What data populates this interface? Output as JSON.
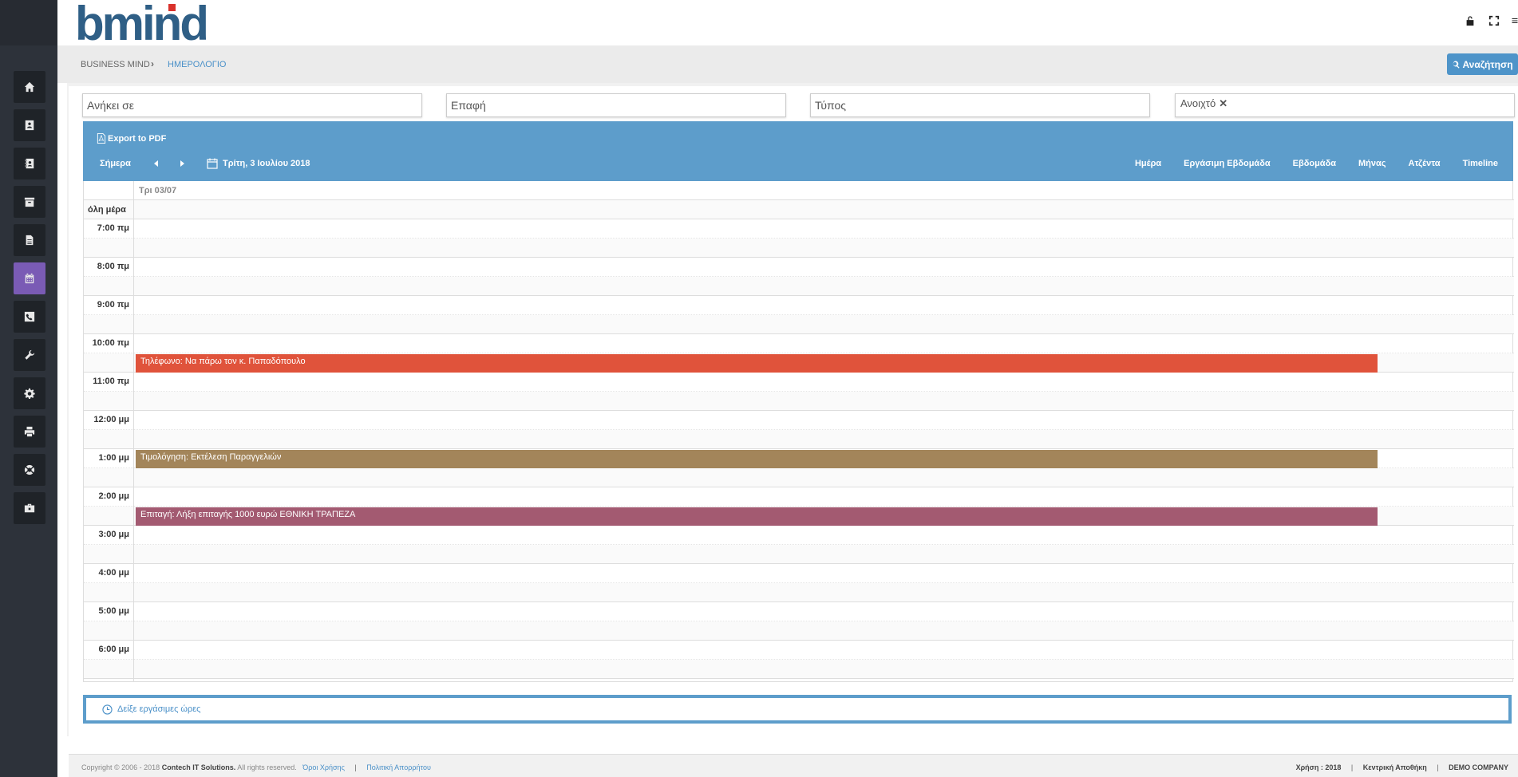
{
  "app": {
    "logo": "bmind",
    "accent": "#5d9dcb",
    "active_nav": "#7a5bb5"
  },
  "sidebar": {
    "items": [
      {
        "icon": "home-icon"
      },
      {
        "icon": "contact-card-icon"
      },
      {
        "icon": "contact-book-icon"
      },
      {
        "icon": "archive-icon"
      },
      {
        "icon": "document-icon"
      },
      {
        "icon": "calendar-icon"
      },
      {
        "icon": "phone-icon"
      },
      {
        "icon": "wrench-icon"
      },
      {
        "icon": "gear-icon"
      },
      {
        "icon": "print-icon"
      },
      {
        "icon": "support-icon"
      },
      {
        "icon": "briefcase-icon"
      }
    ]
  },
  "breadcrumb": {
    "root": "BUSINESS MIND",
    "separator": "›",
    "current": "ΗΜΕΡΟΛΟΓΙΟ"
  },
  "search_button": "Αναζήτηση",
  "filters": {
    "belongs_to": "Ανήκει σε",
    "contact": "Επαφή",
    "type": "Τύπος",
    "status_tag": "Ανοιχτό",
    "status_remove": "✕"
  },
  "toolbar": {
    "export": "Export to PDF",
    "today": "Σήμερα",
    "date": "Τρίτη, 3 Ιουλίου 2018",
    "views": [
      "Ημέρα",
      "Εργάσιμη Εβδομάδα",
      "Εβδομάδα",
      "Μήνας",
      "Ατζέντα",
      "Timeline"
    ]
  },
  "calendar": {
    "day_header": "Τρι 03/07",
    "allday_label": "όλη μέρα",
    "hours": [
      "7:00 πμ",
      "8:00 πμ",
      "9:00 πμ",
      "10:00 πμ",
      "11:00 πμ",
      "12:00 μμ",
      "1:00 μμ",
      "2:00 μμ",
      "3:00 μμ",
      "4:00 μμ",
      "5:00 μμ",
      "6:00 μμ"
    ],
    "events": [
      {
        "title": "Τηλέφωνο: Να πάρω τον κ. Παπαδόπουλο",
        "color": "#e0533b"
      },
      {
        "title": "Τιμολόγηση: Εκτέλεση Παραγγελιών",
        "color": "#a3855a"
      },
      {
        "title": "Επιταγή: Λήξη επιταγής 1000 ευρώ ΕΘΝΙΚΗ ΤΡΑΠΕΖΑ",
        "color": "#a35a71"
      }
    ],
    "show_work_hours": "Δείξε εργάσιμες ώρες"
  },
  "footer": {
    "copyright": "Copyright © 2006 - 2018",
    "company": "Contech IT Solutions.",
    "rights": "All rights reserved.",
    "terms": "Όροι Χρήσης",
    "privacy": "Πολιτική Απορρήτου",
    "year": "Χρήση : 2018",
    "warehouse": "Κεντρική Αποθήκη",
    "demo": "DEMO COMPANY",
    "sep": "|"
  }
}
